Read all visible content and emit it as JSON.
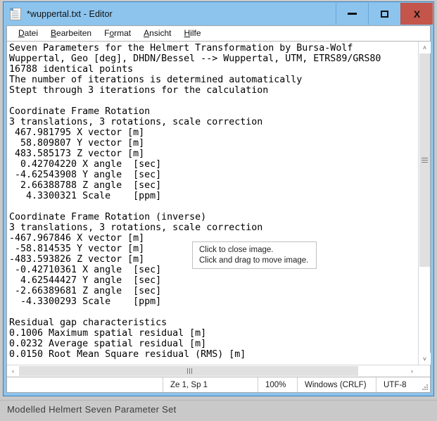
{
  "window": {
    "title": "*wuppertal.txt - Editor",
    "icon": "notepad-document-icon",
    "buttons": {
      "minimize": "minimize-icon",
      "maximize": "maximize-icon",
      "close": "X"
    },
    "colors": {
      "titlebar": "#8cc4ee",
      "close_button": "#c4554a",
      "client": "#ffffff",
      "page_background": "#c9c9c9",
      "scroll_thumb": "#e0e0e0"
    }
  },
  "menu": {
    "items": [
      {
        "label": "Datei",
        "accel": "D"
      },
      {
        "label": "Bearbeiten",
        "accel": "B"
      },
      {
        "label": "Format",
        "accel": "o"
      },
      {
        "label": "Ansicht",
        "accel": "A"
      },
      {
        "label": "Hilfe",
        "accel": "H"
      }
    ]
  },
  "document": {
    "lines": [
      "Seven Parameters for the Helmert Transformation by Bursa-Wolf",
      "Wuppertal, Geo [deg], DHDN/Bessel --> Wuppertal, UTM, ETRS89/GRS80",
      "16788 identical points",
      "The number of iterations is determined automatically",
      "Stept through 3 iterations for the calculation",
      "",
      "Coordinate Frame Rotation",
      "3 translations, 3 rotations, scale correction",
      " 467.981795 X vector [m]",
      "  58.809807 Y vector [m]",
      " 483.585173 Z vector [m]",
      "  0.42704220 X angle  [sec]",
      " -4.62543908 Y angle  [sec]",
      "  2.66388788 Z angle  [sec]",
      "   4.3300321 Scale    [ppm]",
      "",
      "Coordinate Frame Rotation (inverse)",
      "3 translations, 3 rotations, scale correction",
      "-467.967846 X vector [m]",
      " -58.814535 Y vector [m]",
      "-483.593826 Z vector [m]",
      " -0.42710361 X angle  [sec]",
      "  4.62544427 Y angle  [sec]",
      " -2.66389681 Z angle  [sec]",
      "  -4.3300293 Scale    [ppm]",
      "",
      "Residual gap characteristics",
      "0.1006 Maximum spatial residual [m]",
      "0.0232 Average spatial residual [m]",
      "0.0150 Root Mean Square residual (RMS) [m]"
    ]
  },
  "tooltip": {
    "line1": "Click to close image.",
    "line2": "Click and drag to move image."
  },
  "scrollbars": {
    "vertical": {
      "up": "˄",
      "down": "˅"
    },
    "horizontal": {
      "left": "‹",
      "right": "›"
    }
  },
  "statusbar": {
    "blank": "",
    "position": "Ze 1, Sp 1",
    "zoom": "100%",
    "line_ending": "Windows (CRLF)",
    "encoding": "UTF-8"
  },
  "caption": {
    "text": "Modelled Helmert Seven Parameter Set"
  }
}
